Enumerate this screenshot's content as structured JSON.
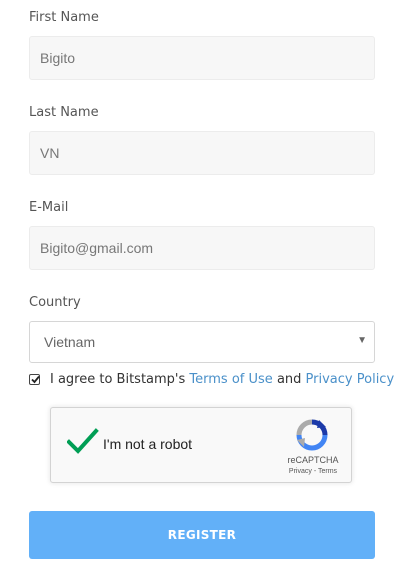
{
  "form": {
    "first_name": {
      "label": "First Name",
      "value": "Bigito"
    },
    "last_name": {
      "label": "Last Name",
      "value": "VN"
    },
    "email": {
      "label": "E-Mail",
      "value": "Bigito@gmail.com"
    },
    "country": {
      "label": "Country",
      "selected": "Vietnam"
    },
    "agree": {
      "checked": true,
      "text_before": "I agree to Bitstamp's",
      "terms_link": "Terms of Use",
      "text_and": "and",
      "privacy_link": "Privacy Policy"
    },
    "captcha": {
      "label": "I'm not a robot",
      "brand": "reCAPTCHA",
      "privacy": "Privacy",
      "separator": "-",
      "terms": "Terms"
    },
    "register_label": "REGISTER"
  },
  "colors": {
    "link": "#4a90c9",
    "button": "#62b0f8",
    "check": "#009e55"
  },
  "icons": {
    "agree_checkbox": "checkmark-icon",
    "select_caret": "caret-down-icon",
    "captcha_check": "green-checkmark-icon",
    "captcha_logo": "recaptcha-logo-icon"
  }
}
